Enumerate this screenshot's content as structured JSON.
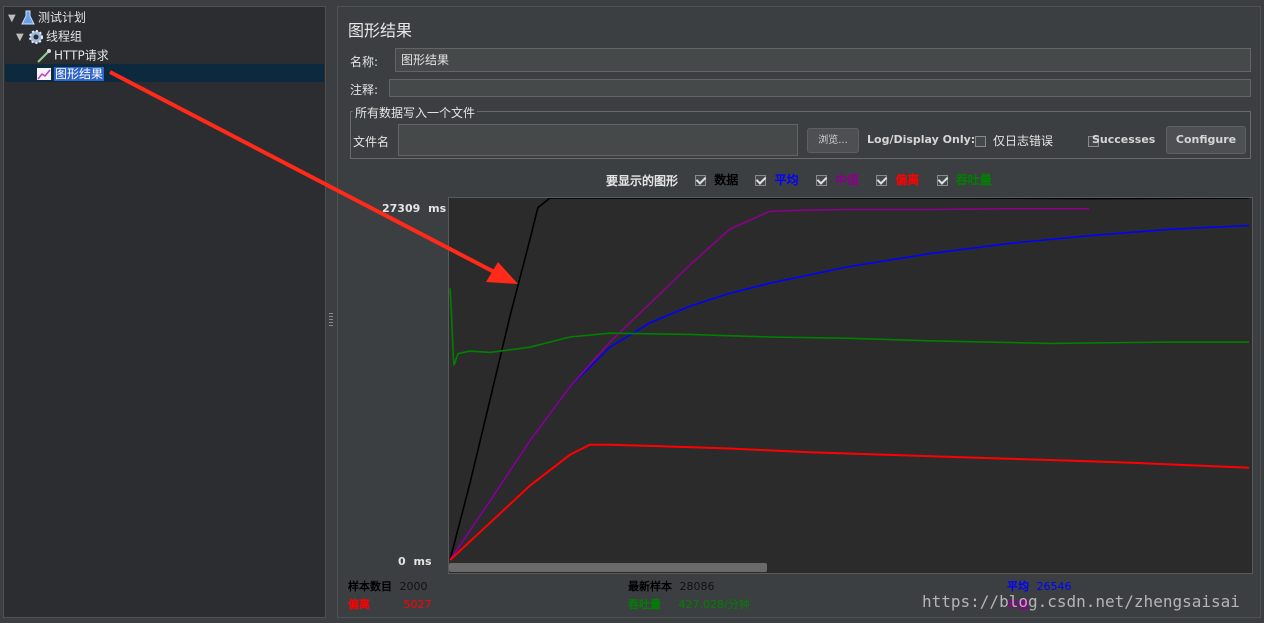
{
  "tree": {
    "items": [
      {
        "label": "测试计划",
        "icon": "flask-icon"
      },
      {
        "label": "线程组",
        "icon": "gear-icon"
      },
      {
        "label": "HTTP请求",
        "icon": "pipette-icon"
      },
      {
        "label": "图形结果",
        "icon": "graph-icon"
      }
    ]
  },
  "panel": {
    "title": "图形结果",
    "name_label": "名称:",
    "name_value": "图形结果",
    "comment_label": "注释:",
    "comment_value": "",
    "file_group_title": "所有数据写入一个文件",
    "filename_label": "文件名",
    "filename_value": "",
    "browse_label": "浏览...",
    "log_display_label": "Log/Display Only:",
    "errors_only_label": "仅日志错误",
    "successes_label": "Successes",
    "configure_label": "Configure"
  },
  "graph_options": {
    "label": "要显示的图形",
    "items": [
      {
        "label": "数据",
        "checked": true,
        "color": "#000000"
      },
      {
        "label": "平均",
        "checked": true,
        "color": "#0000ff"
      },
      {
        "label": "中值",
        "checked": true,
        "color": "#8b008b"
      },
      {
        "label": "偏离",
        "checked": true,
        "color": "#ff0000"
      },
      {
        "label": "吞吐量",
        "checked": true,
        "color": "#008000"
      }
    ]
  },
  "chart_data": {
    "type": "line",
    "y_max_label": "27309",
    "y_min_label": "0",
    "y_unit": "ms",
    "ylim": [
      0,
      27309
    ],
    "samples": 2000,
    "series": [
      {
        "name": "数据",
        "color": "#000000",
        "x": [
          0,
          50,
          100,
          150,
          200,
          220,
          250,
          300,
          400,
          500,
          600,
          800,
          1000,
          1300,
          1600,
          2000
        ],
        "values": [
          0,
          6000,
          12500,
          19000,
          25000,
          27500,
          28500,
          28600,
          28400,
          28300,
          28500,
          28400,
          28300,
          28400,
          28200,
          28300
        ]
      },
      {
        "name": "平均",
        "color": "#0000ff",
        "x": [
          0,
          100,
          200,
          300,
          400,
          500,
          600,
          700,
          800,
          1000,
          1200,
          1400,
          1600,
          1800,
          2000
        ],
        "values": [
          0,
          4600,
          9300,
          13500,
          16600,
          18500,
          19800,
          20800,
          21600,
          22900,
          23900,
          24700,
          25300,
          25800,
          26100
        ]
      },
      {
        "name": "中值",
        "color": "#8b008b",
        "x": [
          0,
          100,
          200,
          300,
          400,
          500,
          600,
          700,
          800,
          900,
          1000,
          1200,
          1400,
          1600
        ],
        "values": [
          0,
          4600,
          9300,
          13500,
          17000,
          20000,
          23000,
          25800,
          27200,
          27300,
          27350,
          27350,
          27400,
          27400
        ]
      },
      {
        "name": "偏离",
        "color": "#ff0000",
        "x": [
          0,
          100,
          200,
          300,
          350,
          400,
          500,
          700,
          900,
          1100,
          1300,
          1500,
          1700,
          2000
        ],
        "values": [
          0,
          2900,
          5800,
          8200,
          9000,
          9000,
          8900,
          8700,
          8400,
          8200,
          8000,
          7800,
          7600,
          7200
        ]
      },
      {
        "name": "吞吐量",
        "color": "#008000",
        "x": [
          0,
          4,
          8,
          10,
          20,
          50,
          100,
          200,
          300,
          400,
          600,
          800,
          1000,
          1200,
          1500,
          1800,
          2000
        ],
        "values": [
          21200,
          19000,
          16000,
          15200,
          16100,
          16300,
          16200,
          16600,
          17400,
          17700,
          17600,
          17400,
          17300,
          17100,
          16900,
          17000,
          17000
        ]
      }
    ]
  },
  "stats": {
    "samples_label": "样本数目",
    "samples_value": "2000",
    "latest_label": "最新样本",
    "latest_value": "28086",
    "average_label": "平均",
    "average_value": "26546",
    "deviation_label": "偏离",
    "deviation_value": "5027",
    "throughput_label": "吞吐量",
    "throughput_value": "427.028/分钟",
    "median_label": "中值"
  },
  "watermark": "https://blog.csdn.net/zhengsaisai",
  "colors": {
    "annotation_arrow": "#ff2a1a",
    "selection": "#2f65ca"
  }
}
